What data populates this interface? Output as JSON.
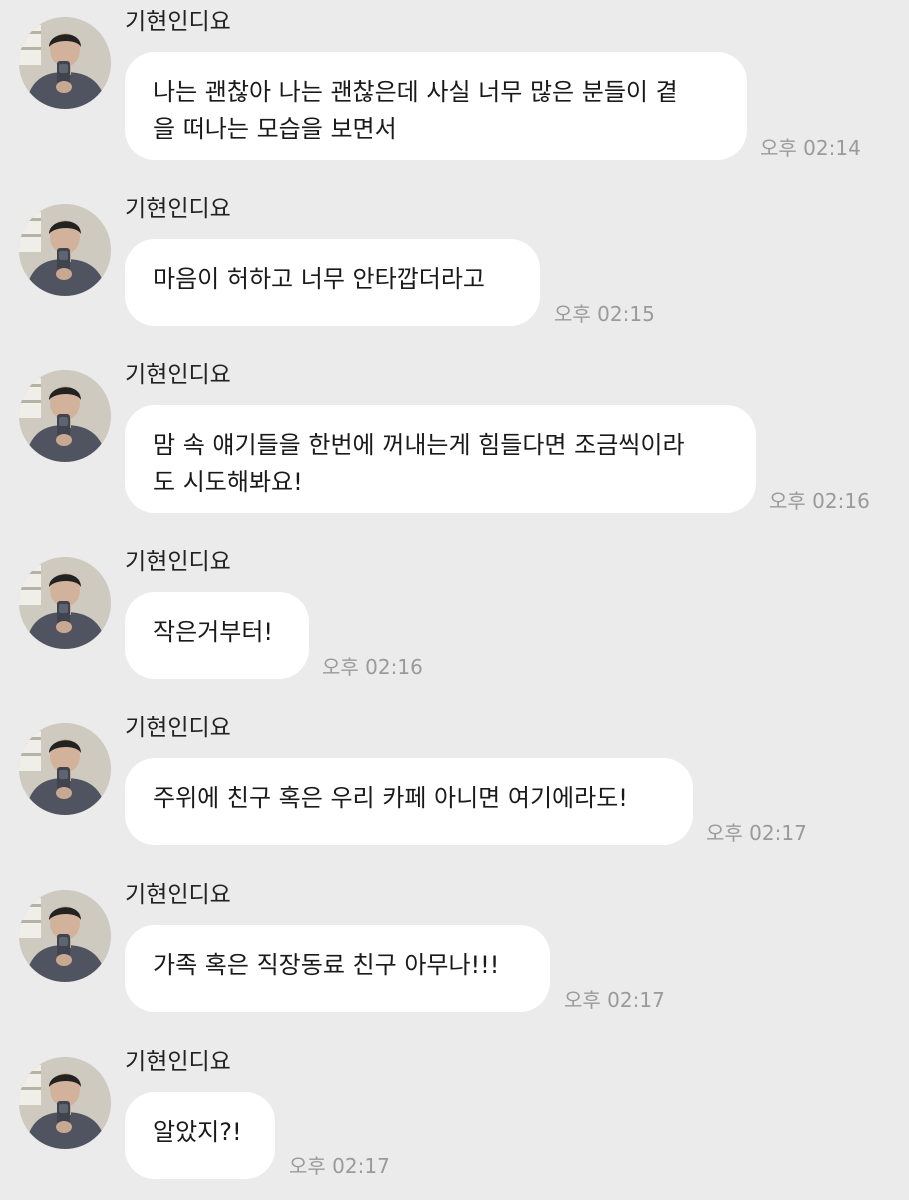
{
  "chat": {
    "messages": [
      {
        "sender": "기현인디요",
        "lines": [
          "나는 괜찮아 나는 괜찮은데 사실 너무 많은 분들이 곁",
          "을 떠나는 모습을 보면서"
        ],
        "time": "오후 02:14"
      },
      {
        "sender": "기현인디요",
        "lines": [
          "마음이 허하고 너무 안타깝더라고"
        ],
        "time": "오후 02:15"
      },
      {
        "sender": "기현인디요",
        "lines": [
          "맘 속 얘기들을 한번에 꺼내는게 힘들다면 조금씩이라",
          "도 시도해봐요!"
        ],
        "time": "오후 02:16"
      },
      {
        "sender": "기현인디요",
        "lines": [
          "작은거부터!"
        ],
        "time": "오후 02:16"
      },
      {
        "sender": "기현인디요",
        "lines": [
          "주위에 친구 혹은 우리 카페 아니면 여기에라도!"
        ],
        "time": "오후 02:17"
      },
      {
        "sender": "기현인디요",
        "lines": [
          "가족 혹은 직장동료 친구 아무나!!!"
        ],
        "time": "오후 02:17"
      },
      {
        "sender": "기현인디요",
        "lines": [
          "알았지?!"
        ],
        "time": "오후 02:17"
      }
    ]
  },
  "avatar": {
    "icon": "profile-photo-icon"
  },
  "colors": {
    "background": "#ebebeb",
    "bubble": "#ffffff",
    "text": "#1a1a1a",
    "time": "#9a9a9a"
  }
}
